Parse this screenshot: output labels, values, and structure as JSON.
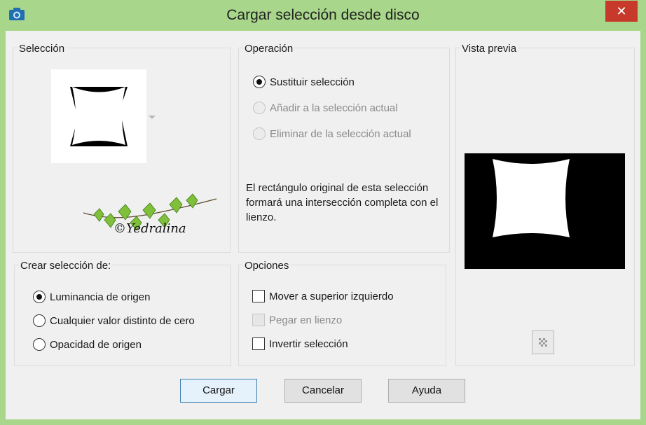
{
  "window": {
    "title": "Cargar selección desde disco",
    "close_label": "✕"
  },
  "seleccion": {
    "title": "Selección",
    "watermark": "©Yedralina"
  },
  "operacion": {
    "title": "Operación",
    "options": [
      {
        "label": "Sustituir selección",
        "checked": true,
        "enabled": true
      },
      {
        "label": "Añadir a la selección actual",
        "checked": false,
        "enabled": false
      },
      {
        "label": "Eliminar de la selección actual",
        "checked": false,
        "enabled": false
      }
    ],
    "description": "El rectángulo original de esta selección formará una intersección completa con el lienzo."
  },
  "vista_previa": {
    "title": "Vista previa"
  },
  "crear": {
    "title": "Crear selección de:",
    "options": [
      {
        "label": "Luminancia de origen",
        "checked": true
      },
      {
        "label": "Cualquier valor distinto de cero",
        "checked": false
      },
      {
        "label": "Opacidad de origen",
        "checked": false
      }
    ]
  },
  "opciones": {
    "title": "Opciones",
    "options": [
      {
        "label": "Mover a superior izquierdo",
        "checked": false,
        "enabled": true
      },
      {
        "label": "Pegar en lienzo",
        "checked": false,
        "enabled": false
      },
      {
        "label": "Invertir selección",
        "checked": false,
        "enabled": true
      }
    ]
  },
  "buttons": {
    "load": "Cargar",
    "cancel": "Cancelar",
    "help": "Ayuda"
  },
  "colors": {
    "titlebar_bg": "#a8d68a",
    "close_bg": "#c7392b",
    "dialog_bg": "#f0f0f0",
    "default_button_border": "#3c7fb1"
  }
}
